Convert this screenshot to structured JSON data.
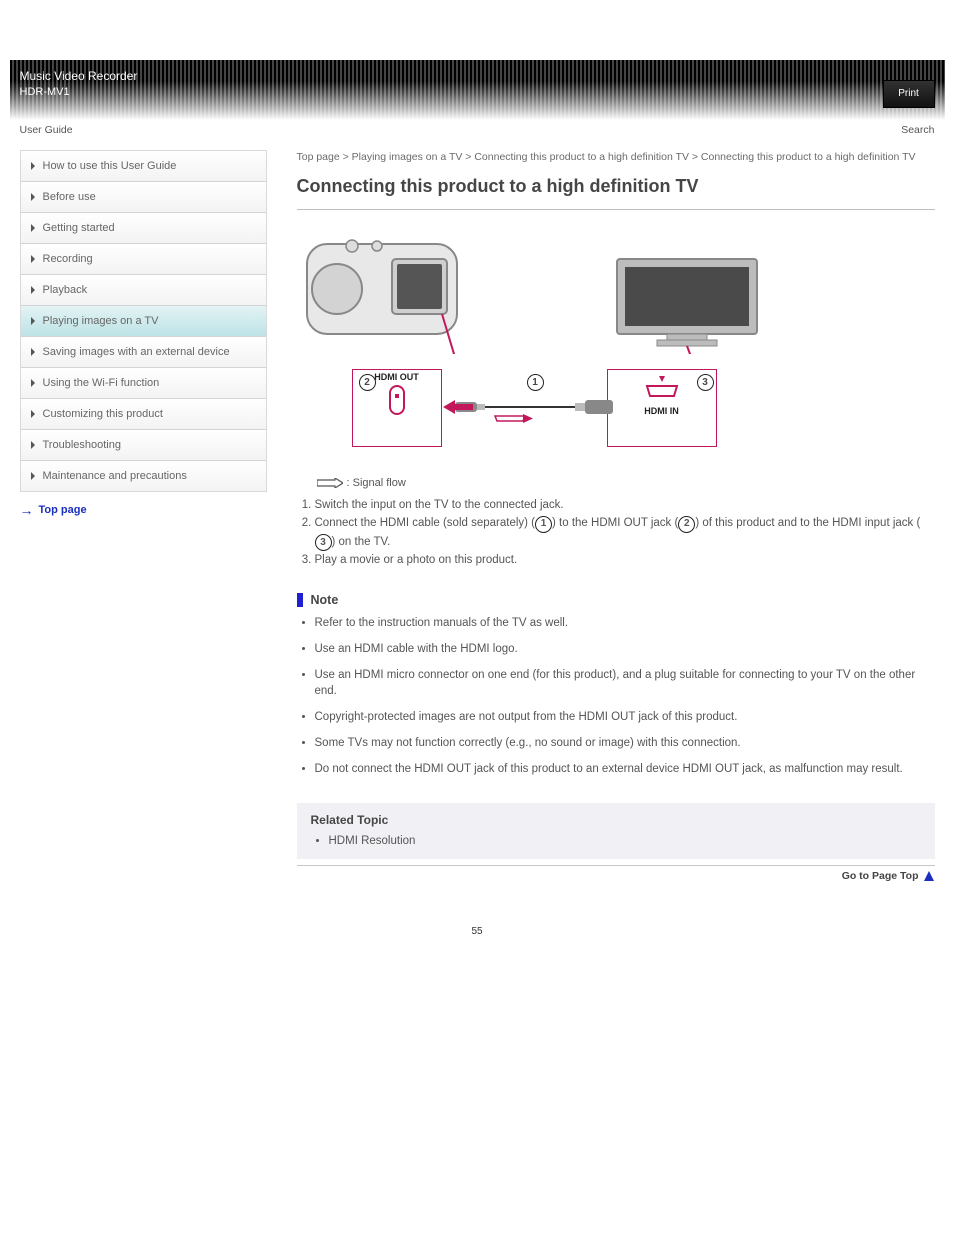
{
  "header": {
    "title": "Music Video Recorder",
    "subtitle": "HDR-MV1",
    "print_label": "Print",
    "left_link": "User Guide",
    "right_link": "Search"
  },
  "sidebar": {
    "items": [
      {
        "label": "How to use this User Guide"
      },
      {
        "label": "Before use"
      },
      {
        "label": "Getting started"
      },
      {
        "label": "Recording"
      },
      {
        "label": "Playback"
      },
      {
        "label": "Playing images on a TV"
      },
      {
        "label": "Saving images with an external device"
      },
      {
        "label": "Using the Wi-Fi function"
      },
      {
        "label": "Customizing this product"
      },
      {
        "label": "Troubleshooting"
      },
      {
        "label": "Maintenance and precautions"
      }
    ],
    "active_index": 5,
    "top_link": "Top page"
  },
  "breadcrumb": "Top page > Playing images on a TV > Connecting this product to a high definition TV > Connecting this product to a high definition TV",
  "title_line1": "Connecting this product to a high definition TV",
  "diagram": {
    "hdmi_out_label": "HDMI OUT",
    "hdmi_in_label": "HDMI IN",
    "flow_label": ": Signal flow"
  },
  "steps": [
    "Switch the input on the TV to the connected jack.",
    "Connect the HDMI cable (sold separately) ( ① ) to the HDMI OUT jack ( ② ) of this product and to the HDMI input jack ( ③ ) on the TV.",
    "Play a movie or a photo on this product."
  ],
  "note_heading": "Note",
  "notes": [
    "Refer to the instruction manuals of the TV as well.",
    "Use an HDMI cable with the HDMI logo.",
    "Use an HDMI micro connector on one end (for this product), and a plug suitable for connecting to your TV on the other end.",
    "Copyright-protected images are not output from the HDMI OUT jack of this product.",
    "Some TVs may not function correctly (e.g., no sound or image) with this connection.",
    "Do not connect the HDMI OUT jack of this product to an external device HDMI OUT jack, as malfunction may result."
  ],
  "related": {
    "heading": "Related Topic",
    "items": [
      "HDMI Resolution"
    ]
  },
  "gotop": "Go to Page Top",
  "page_number": "55"
}
